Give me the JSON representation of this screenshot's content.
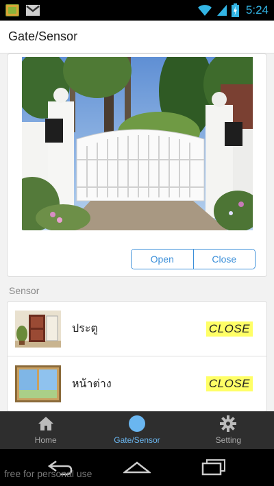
{
  "status_bar": {
    "time": "5:24"
  },
  "header": {
    "title": "Gate/Sensor"
  },
  "gate": {
    "open_label": "Open",
    "close_label": "Close"
  },
  "sensor_section": {
    "label": "Sensor",
    "items": [
      {
        "name": "ประตู",
        "status": "CLOSE",
        "icon": "door-thumbnail"
      },
      {
        "name": "หน้าต่าง",
        "status": "CLOSE",
        "icon": "window-thumbnail"
      }
    ]
  },
  "tabs": [
    {
      "label": "Home",
      "icon": "home-icon",
      "active": false
    },
    {
      "label": "Gate/Sensor",
      "icon": "circle-icon",
      "active": true
    },
    {
      "label": "Setting",
      "icon": "gear-icon",
      "active": false
    }
  ],
  "watermark": "free for personal use",
  "colors": {
    "accent": "#3b8fd9",
    "active_tab": "#6ab6f0",
    "status_badge": "#ffff66",
    "status_time": "#33b5e5"
  }
}
